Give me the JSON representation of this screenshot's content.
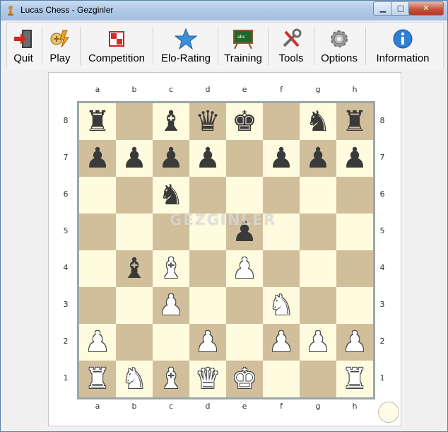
{
  "window": {
    "title": "Lucas Chess - Gezginler",
    "controls": {
      "minimize": "▁",
      "maximize": "□",
      "close": "✕"
    }
  },
  "toolbar": {
    "items": [
      {
        "label": "Quit",
        "icon": "quit-door-icon"
      },
      {
        "label": "Play",
        "icon": "play-pieces-icon"
      },
      {
        "label": "Competition",
        "icon": "competition-icon"
      },
      {
        "label": "Elo-Rating",
        "icon": "star-icon"
      },
      {
        "label": "Training",
        "icon": "blackboard-icon"
      },
      {
        "label": "Tools",
        "icon": "tools-icon"
      },
      {
        "label": "Options",
        "icon": "gear-icon"
      },
      {
        "label": "Information",
        "icon": "info-icon"
      }
    ]
  },
  "board": {
    "files": [
      "a",
      "b",
      "c",
      "d",
      "e",
      "f",
      "g",
      "h"
    ],
    "ranks": [
      "8",
      "7",
      "6",
      "5",
      "4",
      "3",
      "2",
      "1"
    ],
    "colors": {
      "light": "#fffbdf",
      "dark": "#d1bf9c",
      "border": "#9aa7ad"
    },
    "watermark": "GEZGINLER",
    "position": [
      [
        "br",
        "",
        "bb",
        "bq",
        "bk",
        "",
        "bn",
        "br"
      ],
      [
        "bp",
        "bp",
        "bp",
        "bp",
        "",
        "bp",
        "bp",
        "bp"
      ],
      [
        "",
        "",
        "bn",
        "",
        "",
        "",
        "",
        ""
      ],
      [
        "",
        "",
        "",
        "",
        "bp",
        "",
        "",
        ""
      ],
      [
        "",
        "bb",
        "wb",
        "",
        "wp",
        "",
        "",
        ""
      ],
      [
        "",
        "",
        "wp",
        "",
        "",
        "wn",
        "",
        ""
      ],
      [
        "wp",
        "",
        "",
        "wp",
        "",
        "wp",
        "wp",
        "wp"
      ],
      [
        "wr",
        "wn",
        "wb",
        "wq",
        "wk",
        "",
        "",
        "wr"
      ]
    ],
    "side_to_move": "white"
  }
}
